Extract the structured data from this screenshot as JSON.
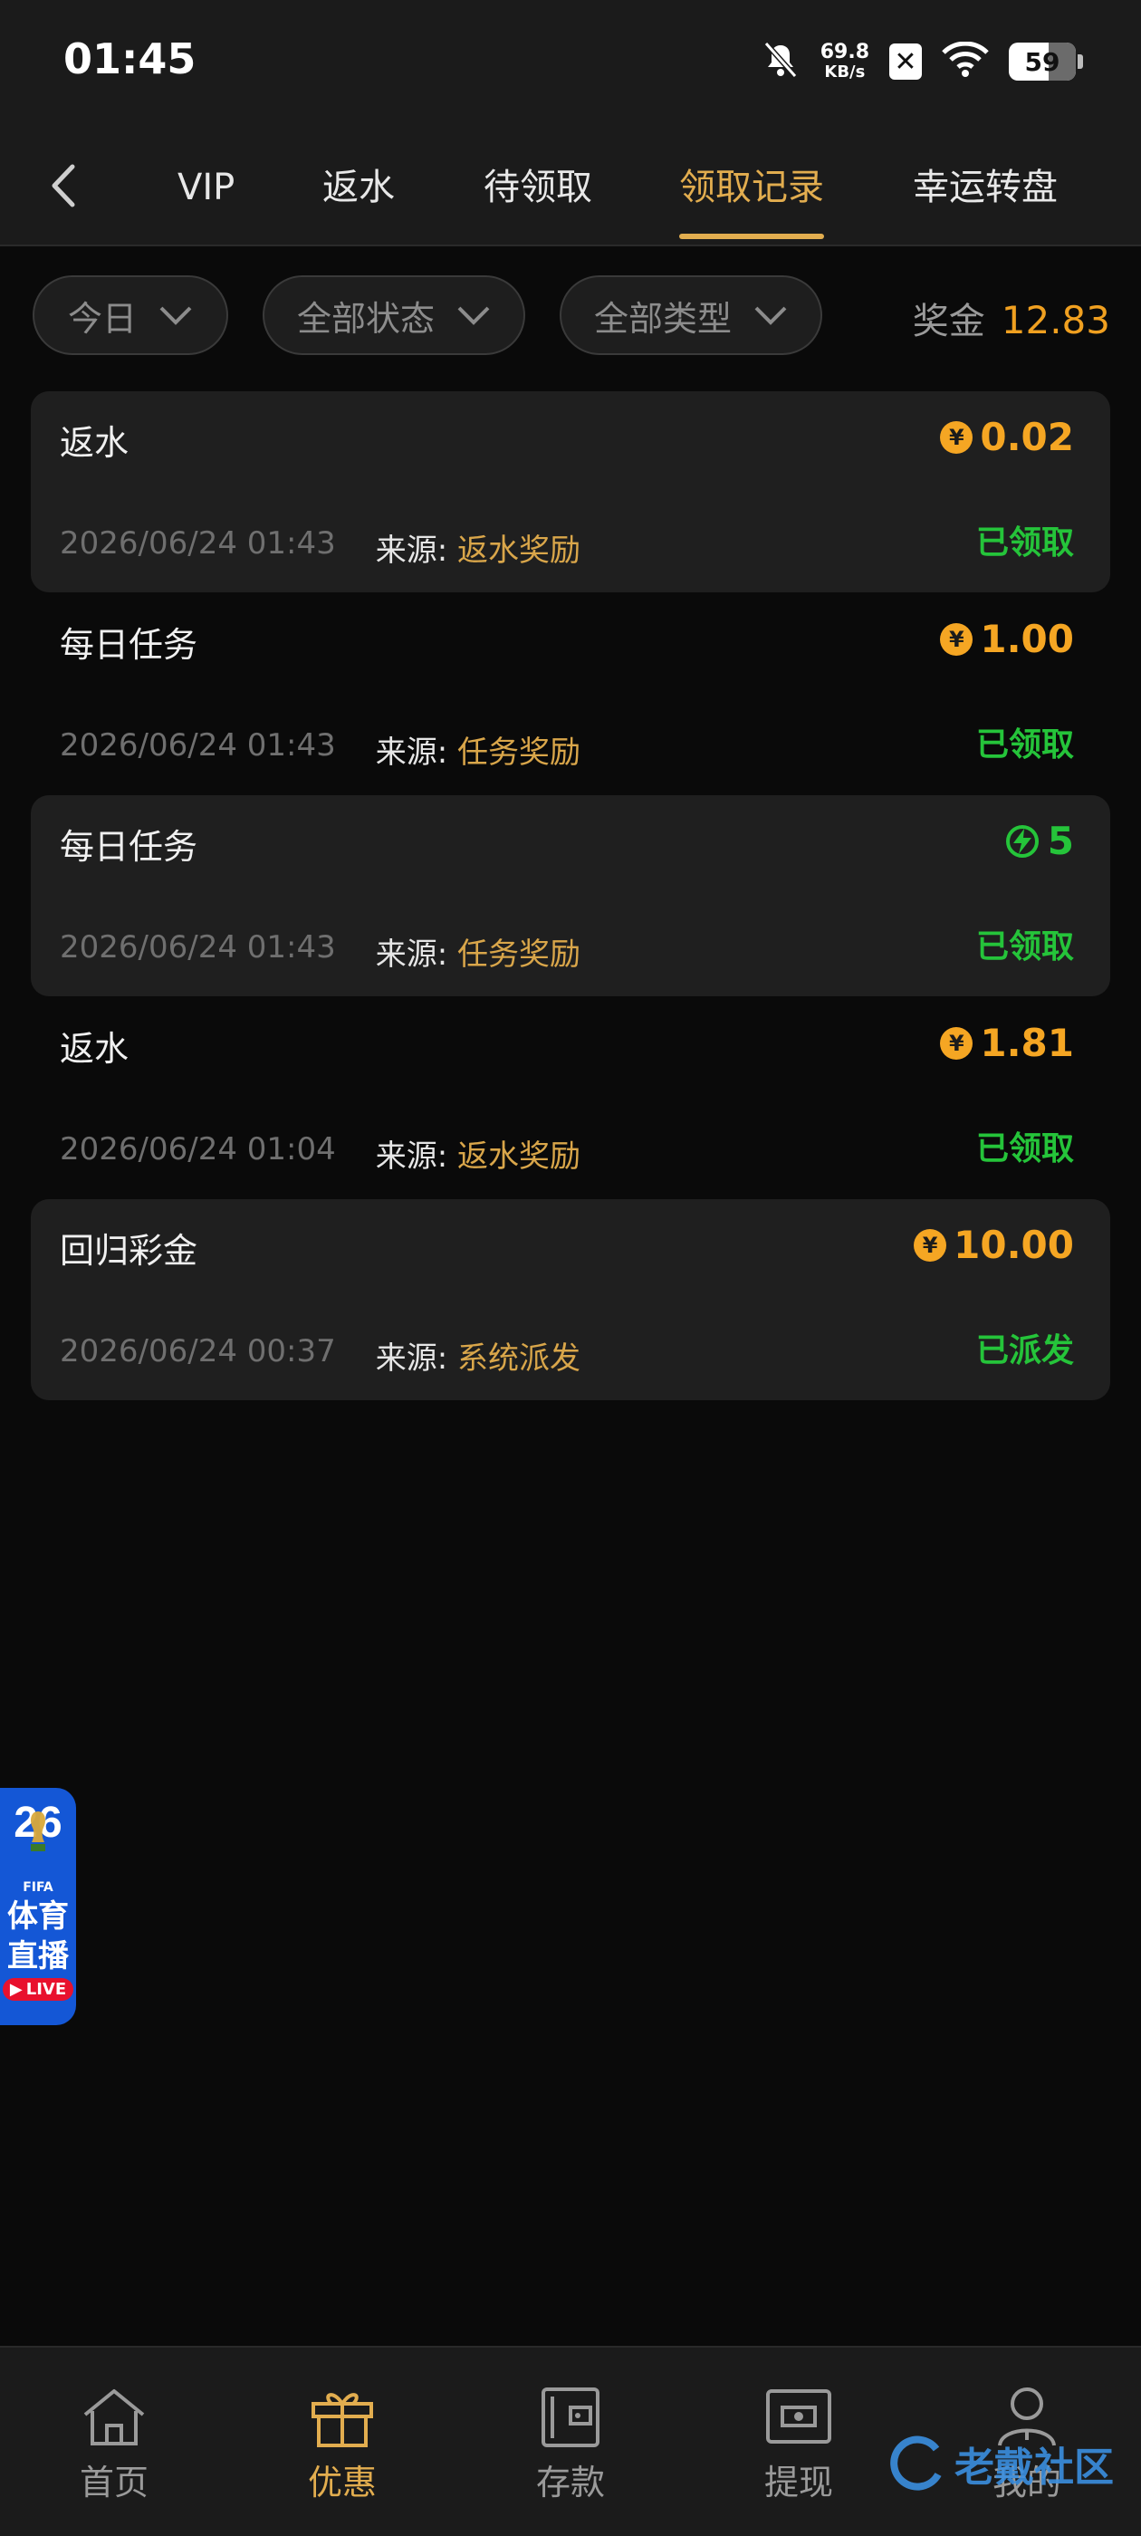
{
  "status_bar": {
    "time": "01:45",
    "net_speed_value": "69.8",
    "net_speed_unit": "KB/s",
    "battery": "59",
    "icons": [
      "bell-muted-icon",
      "x-app-icon",
      "wifi-icon",
      "battery-icon"
    ]
  },
  "header": {
    "tabs": [
      {
        "label": "VIP",
        "active": false
      },
      {
        "label": "返水",
        "active": false
      },
      {
        "label": "待领取",
        "active": false
      },
      {
        "label": "领取记录",
        "active": true
      },
      {
        "label": "幸运转盘",
        "active": false
      }
    ]
  },
  "filters": {
    "date": "今日",
    "status": "全部状态",
    "type": "全部类型",
    "bonus_label": "奖金",
    "bonus_value": "12.83"
  },
  "records": [
    {
      "title": "返水",
      "amount": "0.02",
      "currency_icon": "yuan-coin-icon",
      "time": "2026/06/24 01:43",
      "source_label": "来源:",
      "source": "返水奖励",
      "status": "已领取"
    },
    {
      "title": "每日任务",
      "amount": "1.00",
      "currency_icon": "yuan-coin-icon",
      "time": "2026/06/24 01:43",
      "source_label": "来源:",
      "source": "任务奖励",
      "status": "已领取"
    },
    {
      "title": "每日任务",
      "amount": "5",
      "currency_icon": "lightning-icon",
      "time": "2026/06/24 01:43",
      "source_label": "来源:",
      "source": "任务奖励",
      "status": "已领取"
    },
    {
      "title": "返水",
      "amount": "1.81",
      "currency_icon": "yuan-coin-icon",
      "time": "2026/06/24 01:04",
      "source_label": "来源:",
      "source": "返水奖励",
      "status": "已领取"
    },
    {
      "title": "回归彩金",
      "amount": "10.00",
      "currency_icon": "yuan-coin-icon",
      "time": "2026/06/24 00:37",
      "source_label": "来源:",
      "source": "系统派发",
      "status": "已派发"
    }
  ],
  "floating_badge": {
    "year": "26",
    "brand": "FIFA",
    "line1": "体育",
    "line2": "直播",
    "live": "LIVE"
  },
  "bottom_nav": [
    {
      "label": "首页",
      "icon": "home-icon",
      "active": false
    },
    {
      "label": "优惠",
      "icon": "gift-icon",
      "active": true
    },
    {
      "label": "存款",
      "icon": "wallet-icon",
      "active": false
    },
    {
      "label": "提现",
      "icon": "cash-icon",
      "active": false
    },
    {
      "label": "我的",
      "icon": "user-icon",
      "active": false
    }
  ],
  "watermark": "老戴社区",
  "colors": {
    "accent": "#e2ad4f",
    "amount": "#f5a623",
    "success": "#25c43a",
    "background": "#0a0a0a",
    "surface": "#1f1f1f"
  }
}
